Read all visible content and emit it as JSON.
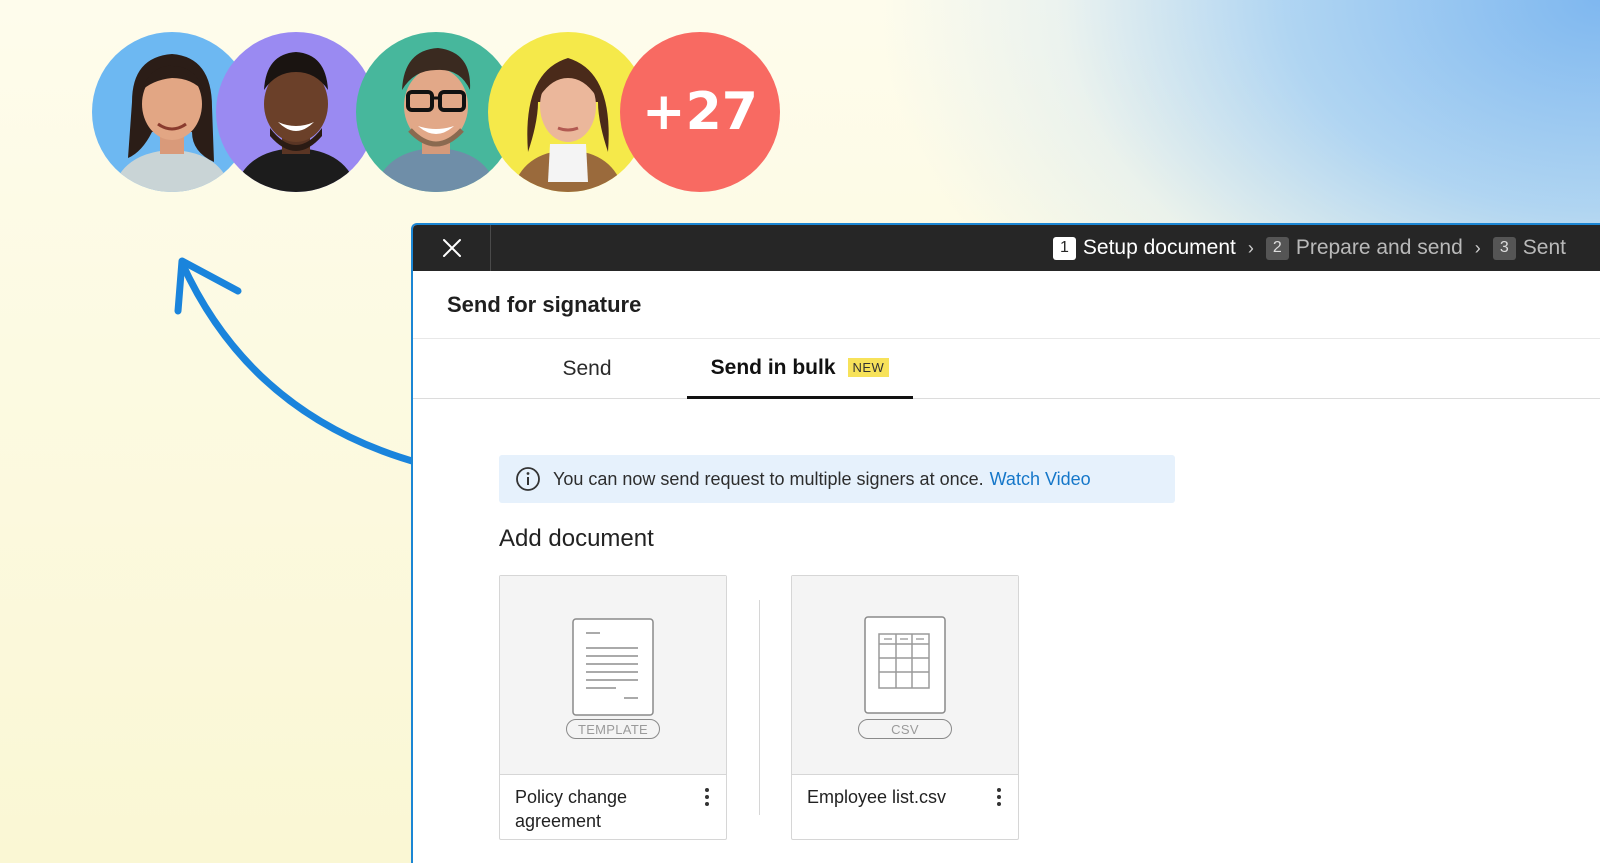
{
  "avatars": {
    "people": [
      {
        "name": "person-1",
        "bg": "#6db8f2"
      },
      {
        "name": "person-2",
        "bg": "#9a8af2"
      },
      {
        "name": "person-3",
        "bg": "#47b79c"
      },
      {
        "name": "person-4",
        "bg": "#f5e94a"
      }
    ],
    "more_count": "+27"
  },
  "dialog": {
    "steps": [
      {
        "num": "1",
        "label": "Setup document"
      },
      {
        "num": "2",
        "label": "Prepare and send"
      },
      {
        "num": "3",
        "label": "Sent"
      }
    ],
    "title": "Send for signature",
    "tabs": {
      "send": "Send",
      "bulk": "Send in bulk",
      "bulk_badge": "NEW"
    },
    "info": {
      "text": "You can now send request to multiple signers at once.",
      "link": "Watch Video"
    },
    "section_title": "Add document",
    "cards": [
      {
        "type_label": "TEMPLATE",
        "file_name": "Policy change agreement"
      },
      {
        "type_label": "CSV",
        "file_name": "Employee list.csv"
      }
    ]
  },
  "colors": {
    "accent": "#1b86d4",
    "topbar": "#262626",
    "count_badge": "#f86a62",
    "new_badge": "#f7e25a",
    "link": "#1577c9"
  }
}
